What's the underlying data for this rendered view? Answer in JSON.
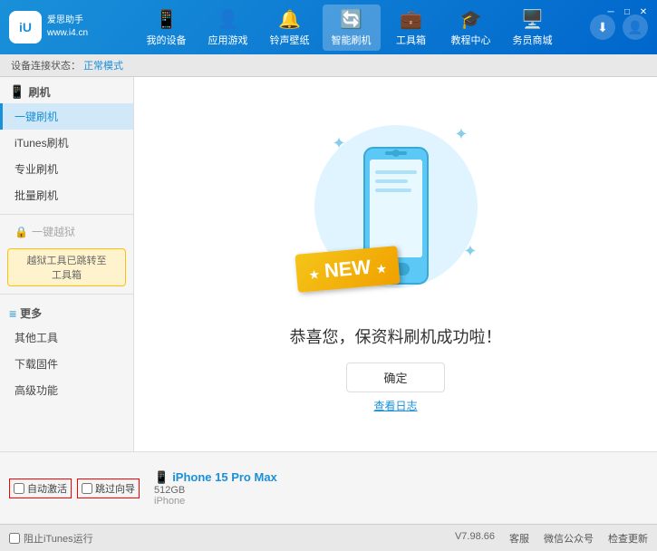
{
  "header": {
    "logo_text1": "爱思助手",
    "logo_text2": "www.i4.cn",
    "logo_symbol": "iU",
    "nav": [
      {
        "id": "my-device",
        "label": "我的设备",
        "icon": "📱"
      },
      {
        "id": "apps-games",
        "label": "应用游戏",
        "icon": "👤"
      },
      {
        "id": "ringtones",
        "label": "铃声壁纸",
        "icon": "🔔"
      },
      {
        "id": "smart-flash",
        "label": "智能刷机",
        "icon": "🔄",
        "active": true
      },
      {
        "id": "tools",
        "label": "工具箱",
        "icon": "💼"
      },
      {
        "id": "tutorials",
        "label": "教程中心",
        "icon": "🎓"
      },
      {
        "id": "service",
        "label": "务员商城",
        "icon": "🖥️"
      }
    ],
    "download_icon": "⬇",
    "user_icon": "👤"
  },
  "breadcrumb": {
    "prefix": "设备连接状态：",
    "status": "正常模式"
  },
  "sidebar": {
    "section1_header": "刷机",
    "items": [
      {
        "id": "one-key-flash",
        "label": "一键刷机",
        "active": true
      },
      {
        "id": "itunes-flash",
        "label": "iTunes刷机"
      },
      {
        "id": "pro-flash",
        "label": "专业刷机"
      },
      {
        "id": "batch-flash",
        "label": "批量刷机"
      }
    ],
    "disabled_label": "一键越狱",
    "info_box": "越狱工具已跳转至\n工具箱",
    "section2_header": "更多",
    "more_items": [
      {
        "id": "other-tools",
        "label": "其他工具"
      },
      {
        "id": "download-firmware",
        "label": "下载固件"
      },
      {
        "id": "advanced",
        "label": "高级功能"
      }
    ]
  },
  "content": {
    "success_text": "恭喜您，保资料刷机成功啦！",
    "confirm_button": "确定",
    "log_link": "查看日志",
    "new_badge": "NEW",
    "phone_color": "#5bc8f5"
  },
  "device_bar": {
    "auto_activate": "自动激活",
    "guide_label": "跳过向导",
    "device_icon": "📱",
    "device_name": "iPhone 15 Pro Max",
    "storage": "512GB",
    "type": "iPhone"
  },
  "footer": {
    "itunes_label": "阻止iTunes运行",
    "version": "V7.98.66",
    "links": [
      "客服",
      "微信公众号",
      "检查更新"
    ]
  }
}
